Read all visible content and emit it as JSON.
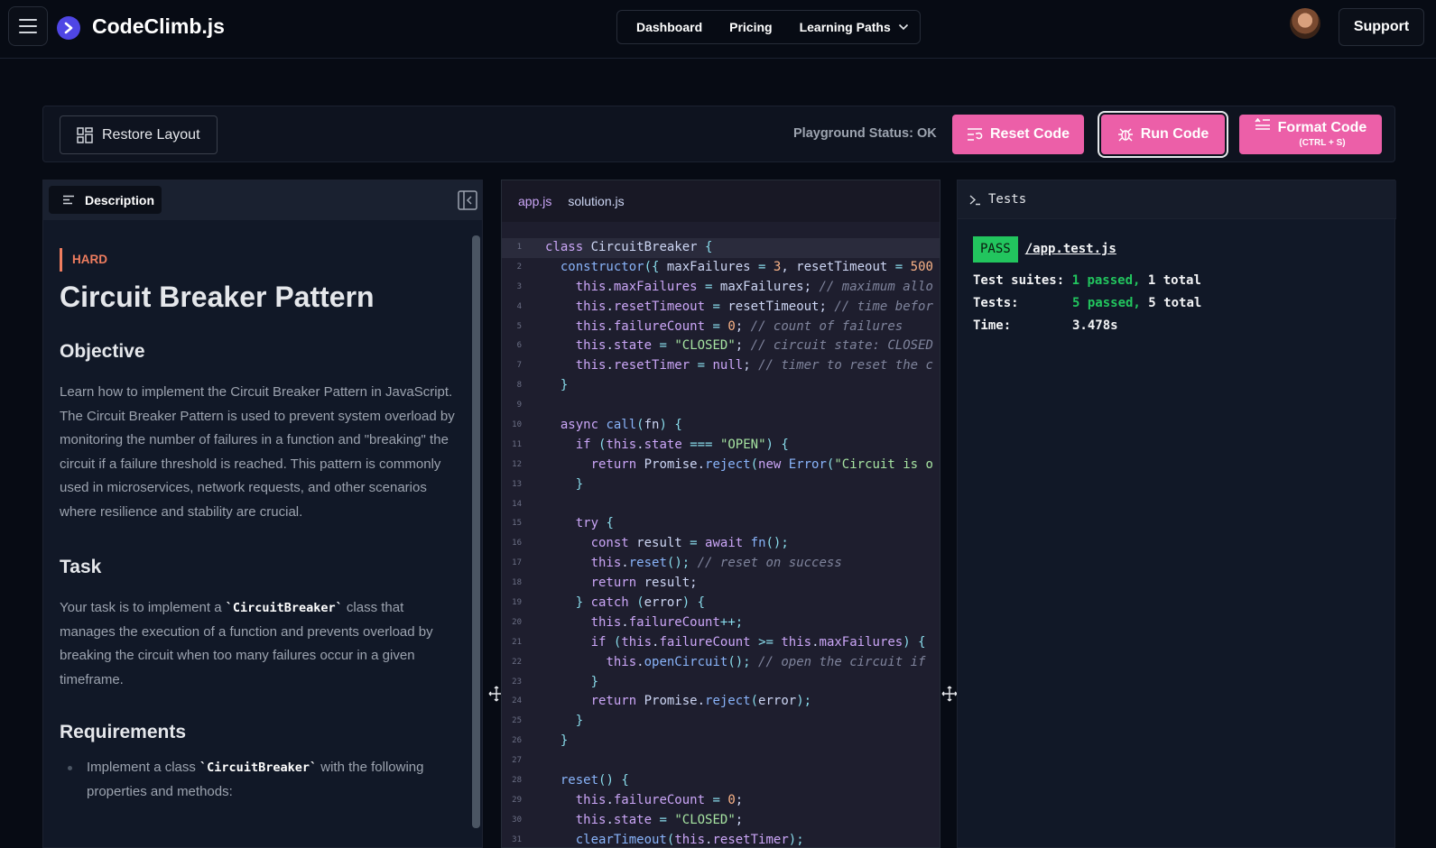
{
  "nav": {
    "brand": "CodeClimb.js",
    "links": [
      "Dashboard",
      "Pricing",
      "Learning Paths"
    ],
    "support": "Support"
  },
  "toolbar": {
    "restore_label": "Restore Layout",
    "status": "Playground Status: OK",
    "reset_label": "Reset Code",
    "run_label": "Run Code",
    "format_label": "Format Code",
    "format_shortcut": "(CTRL + S)"
  },
  "description": {
    "tab_label": "Description",
    "difficulty": "HARD",
    "title": "Circuit Breaker Pattern",
    "objective_heading": "Objective",
    "objective_text": "Learn how to implement the Circuit Breaker Pattern in JavaScript. The Circuit Breaker Pattern is used to prevent system overload by monitoring the number of failures in a function and \"breaking\" the circuit if a failure threshold is reached. This pattern is commonly used in microservices, network requests, and other scenarios where resilience and stability are crucial.",
    "task_heading": "Task",
    "task_pre": "Your task is to implement a ",
    "task_code": "`CircuitBreaker`",
    "task_post": " class that manages the execution of a function and prevents overload by breaking the circuit when too many failures occur in a given timeframe.",
    "requirements_heading": "Requirements",
    "req_pre": "Implement a class ",
    "req_code": "`CircuitBreaker`",
    "req_post": " with the following properties and methods:"
  },
  "editor": {
    "tabs": [
      "app.js",
      "solution.js"
    ],
    "active_tab": "app.js",
    "current_line": 1
  },
  "tests": {
    "header": "Tests",
    "status": "PASS",
    "file": "/app.test.js",
    "suites_label": "Test suites:",
    "suites_passed": "1 passed,",
    "suites_total": "1 total",
    "tests_label": "Tests:",
    "tests_passed": "5 passed,",
    "tests_total": "5 total",
    "time_label": "Time:",
    "time_value": "3.478s"
  },
  "colors": {
    "accent_pink": "#ec5fa8",
    "difficulty_hard": "#ef7d5f",
    "pass_green": "#22c55e",
    "logo_blue": "#4f46e5"
  },
  "icons": [
    "menu-icon",
    "logo-icon",
    "chevron-down-icon",
    "layout-grid-icon",
    "reset-list-icon",
    "bug-icon",
    "format-text-icon",
    "description-lines-icon",
    "collapse-panel-icon",
    "terminal-prompt-icon",
    "move-arrows-icon"
  ]
}
